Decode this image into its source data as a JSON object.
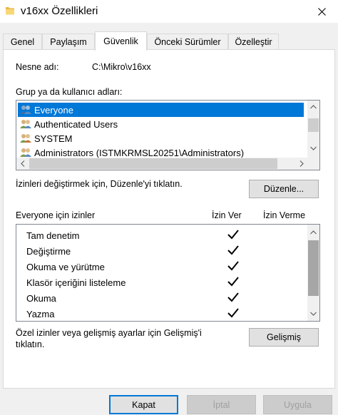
{
  "window": {
    "title": "v16xx Özellikleri"
  },
  "tabs": [
    {
      "label": "Genel",
      "active": false
    },
    {
      "label": "Paylaşım",
      "active": false
    },
    {
      "label": "Güvenlik",
      "active": true
    },
    {
      "label": "Önceki Sürümler",
      "active": false
    },
    {
      "label": "Özelleştir",
      "active": false
    }
  ],
  "security": {
    "object_label": "Nesne adı:",
    "object_value": "C:\\Mikro\\v16xx",
    "groups_label": "Grup ya da kullanıcı adları:",
    "groups": [
      {
        "name": "Everyone",
        "selected": true,
        "icon": "users-group-icon"
      },
      {
        "name": "Authenticated Users",
        "selected": false,
        "icon": "users-group-icon"
      },
      {
        "name": "SYSTEM",
        "selected": false,
        "icon": "users-group-icon"
      },
      {
        "name": "Administrators (ISTMKRMSL20251\\Administrators)",
        "selected": false,
        "icon": "users-group-icon"
      }
    ],
    "edit_hint": "İzinleri değiştirmek için, Düzenle'yi tıklatın.",
    "edit_button": "Düzenle...",
    "perm_header": "Everyone için izinler",
    "allow_header": "İzin Ver",
    "deny_header": "İzin Verme",
    "permissions": [
      {
        "name": "Tam denetim",
        "allow": true,
        "deny": false
      },
      {
        "name": "Değiştirme",
        "allow": true,
        "deny": false
      },
      {
        "name": "Okuma ve yürütme",
        "allow": true,
        "deny": false
      },
      {
        "name": "Klasör içeriğini listeleme",
        "allow": true,
        "deny": false
      },
      {
        "name": "Okuma",
        "allow": true,
        "deny": false
      },
      {
        "name": "Yazma",
        "allow": true,
        "deny": false
      }
    ],
    "advanced_hint_line1": "Özel izinler veya gelişmiş ayarlar için Gelişmiş'i",
    "advanced_hint_line2": "tıklatın.",
    "advanced_button": "Gelişmiş"
  },
  "footer": {
    "ok": "Kapat",
    "cancel": "İptal",
    "apply": "Uygula"
  },
  "colors": {
    "selection": "#0078d7",
    "folder": "#f8d775"
  }
}
